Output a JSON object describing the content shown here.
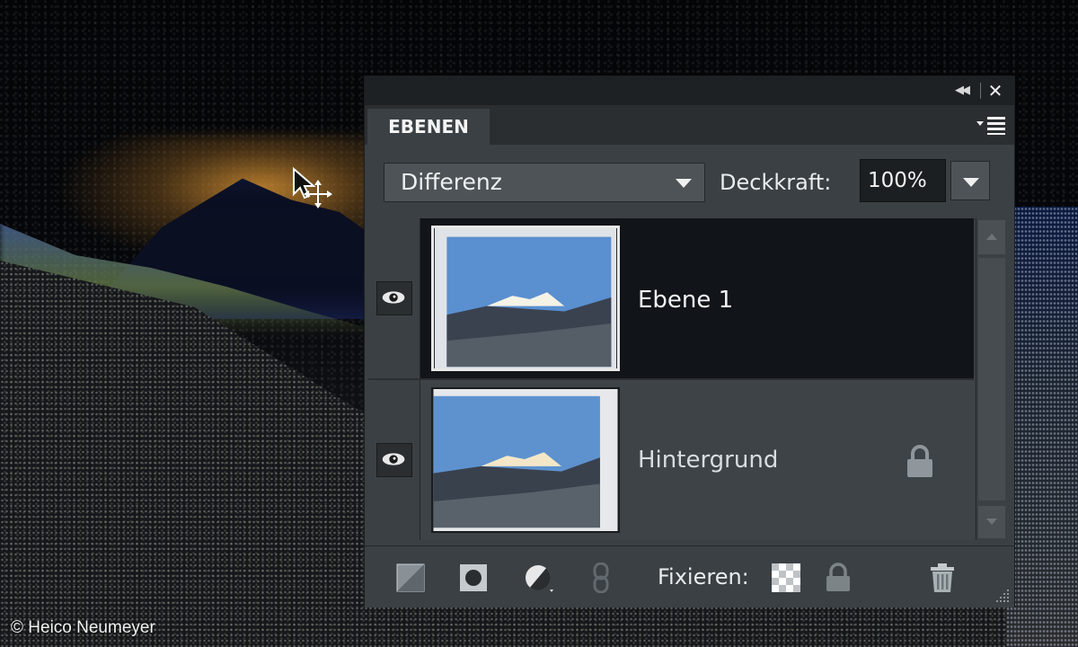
{
  "panel": {
    "tab_label": "EBENEN",
    "blend_mode": "Differenz",
    "opacity_label": "Deckkraft:",
    "opacity_value": "100%",
    "fix_label": "Fixieren:"
  },
  "layers": [
    {
      "name": "Ebene 1",
      "selected": true
    },
    {
      "name": "Hintergrund",
      "locked": true
    }
  ],
  "icons": {
    "collapse": "double-chevron-left-icon",
    "close": "close-icon",
    "panel_menu": "panel-menu-icon",
    "visibility": "eye-icon",
    "lock": "lock-icon",
    "new_layer": "new-layer-icon",
    "layer_mask": "layer-mask-icon",
    "adjustment": "adjustment-layer-icon",
    "link": "link-icon",
    "lock_transparent": "lock-transparent-pixels-icon",
    "lock_all": "lock-all-icon",
    "delete": "trash-icon"
  },
  "colors": {
    "panel_bg": "#3b4044",
    "selected_row": "#111418",
    "text": "#f1f3f4"
  },
  "copyright": "© Heico Neumeyer"
}
